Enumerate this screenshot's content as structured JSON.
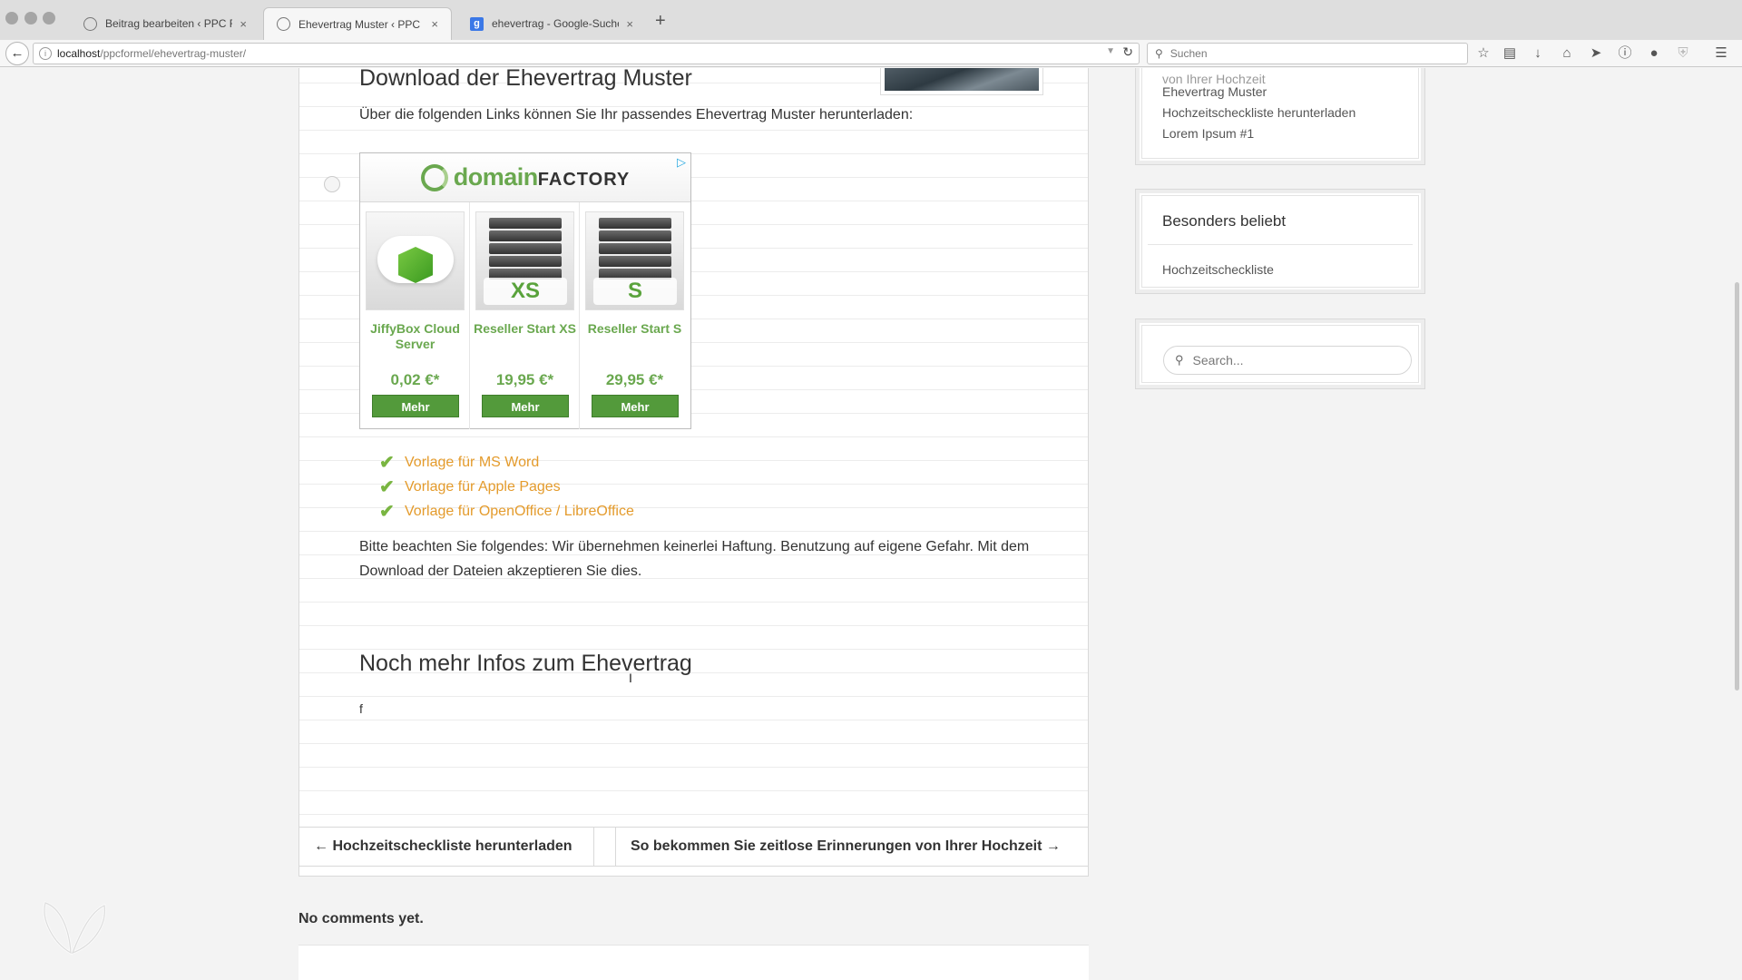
{
  "browser": {
    "tabs": [
      {
        "title": "Beitrag bearbeiten ‹ PPC Fo...",
        "active": false
      },
      {
        "title": "Ehevertrag Muster ‹ PPC Fo...",
        "active": true
      },
      {
        "title": "ehevertrag - Google-Suche",
        "active": false
      }
    ],
    "new_tab": "+",
    "close_glyph": "×",
    "url_host": "localhost",
    "url_path": "/ppcformel/ehevertrag-muster/",
    "search_placeholder": "Suchen",
    "google_letter": "g",
    "toolbar_icons": [
      "star-icon",
      "reading-list-icon",
      "download-icon",
      "home-icon",
      "send-icon",
      "info-icon",
      "chat-icon",
      "shield-icon",
      "menu-icon"
    ]
  },
  "article": {
    "heading_top": "Download der Ehevertrag Muster",
    "intro": "Über die folgenden Links können Sie Ihr passendes Ehevertrag Muster herunterladen:",
    "ad": {
      "brand_main": "domain",
      "brand_sub": "FACTORY",
      "products": [
        {
          "name": "JiffyBox Cloud Server",
          "price": "0,02 €*",
          "button": "Mehr"
        },
        {
          "name": "Reseller Start XS",
          "price": "19,95 €*",
          "button": "Mehr",
          "badge": "XS"
        },
        {
          "name": "Reseller Start S",
          "price": "29,95 €*",
          "button": "Mehr",
          "badge": "S"
        }
      ]
    },
    "downloads": [
      "Vorlage für MS Word",
      "Vorlage für Apple Pages",
      "Vorlage für OpenOffice / LibreOffice"
    ],
    "disclaimer": "Bitte beachten Sie folgendes: Wir übernehmen keinerlei Haftung. Benutzung auf eigene Gefahr. Mit dem Download der Dateien akzeptieren Sie dies.",
    "heading_second": "Noch mehr Infos zum Ehevertrag",
    "stray_text": "f"
  },
  "post_nav": {
    "prev": "← Hochzeitscheckliste herunterladen",
    "next": "So bekommen Sie zeitlose Erinnerungen von Ihrer Hochzeit →"
  },
  "comments": {
    "empty": "No comments yet."
  },
  "sidebar": {
    "recent_items": [
      "von Ihrer Hochzeit",
      "Ehevertrag Muster",
      "Hochzeitscheckliste herunterladen",
      "Lorem Ipsum #1"
    ],
    "popular_title": "Besonders beliebt",
    "popular_items": [
      "Hochzeitscheckliste"
    ],
    "search_placeholder": "Search..."
  }
}
